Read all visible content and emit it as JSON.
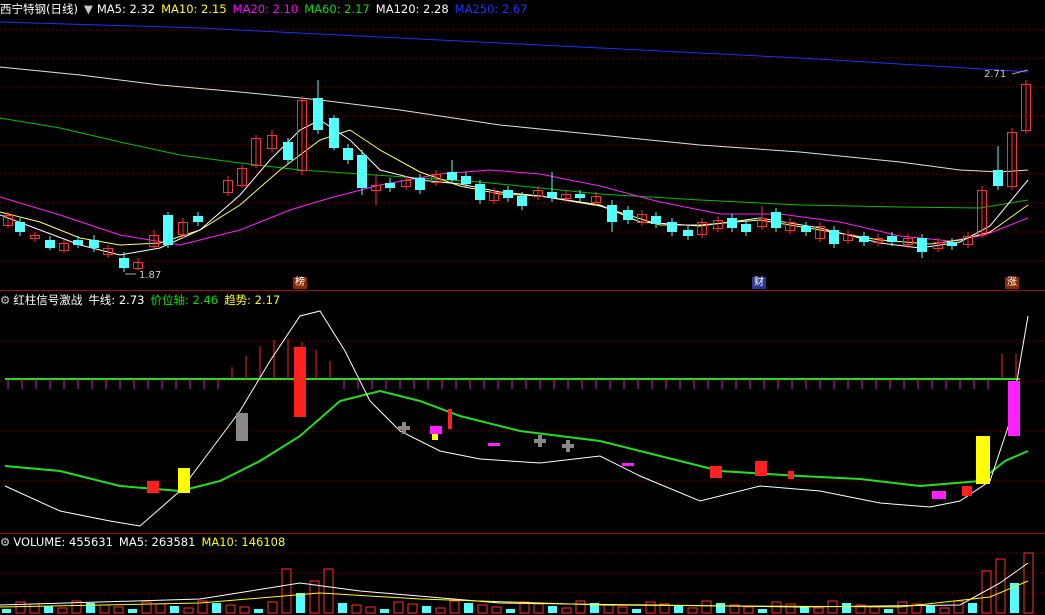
{
  "main": {
    "title": "西宁特钢(日线)",
    "ma": [
      {
        "label": "MA5: 2.32",
        "color": "#ffffff"
      },
      {
        "label": "MA10: 2.15",
        "color": "#ffff00"
      },
      {
        "label": "MA20: 2.10",
        "color": "#ff00ff"
      },
      {
        "label": "MA60: 2.17",
        "color": "#00e000"
      },
      {
        "label": "MA120: 2.28",
        "color": "#ffffff"
      },
      {
        "label": "MA250: 2.67",
        "color": "#2030ff"
      }
    ],
    "high_label": "2.71",
    "low_label": "1.87",
    "markers": [
      "榜",
      "财",
      "涨"
    ]
  },
  "indicator": {
    "title": "红柱信号激战",
    "items": [
      {
        "label": "牛线: 2.73",
        "color": "#ffffff"
      },
      {
        "label": "价位轴: 2.46",
        "color": "#00e000"
      },
      {
        "label": "趋势: 2.17",
        "color": "#ffff00"
      }
    ]
  },
  "volume": {
    "items": [
      {
        "label": "VOLUME: 455631",
        "color": "#ffffff"
      },
      {
        "label": "MA5: 263581",
        "color": "#ffffff"
      },
      {
        "label": "MA10: 146108",
        "color": "#ffff00"
      }
    ]
  },
  "colors": {
    "up": "#ff3030",
    "down": "#54ffff",
    "grid": "#7a0000"
  }
}
